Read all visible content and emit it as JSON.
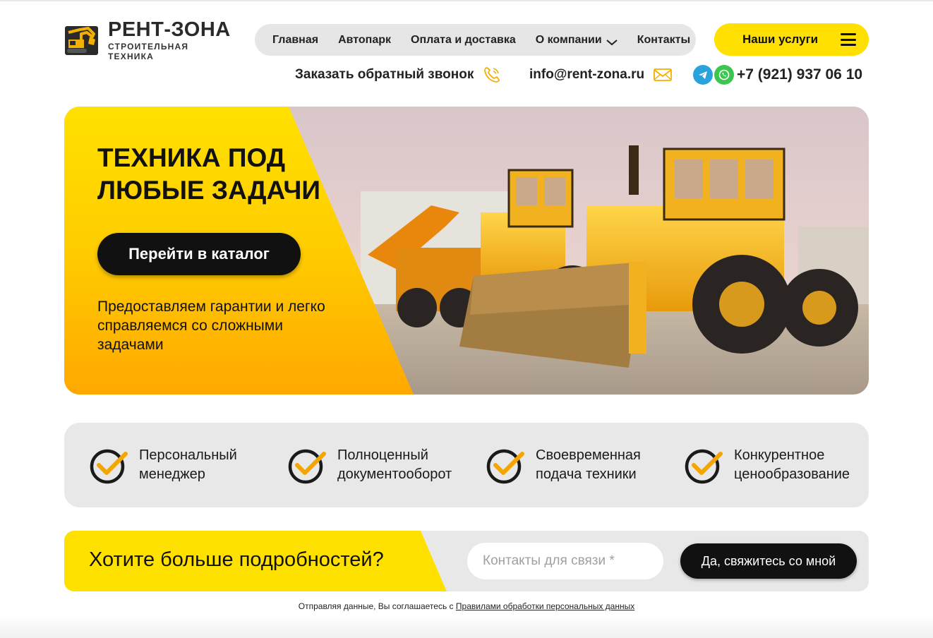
{
  "brand": {
    "name": "РЕНТ-ЗОНА",
    "tagline": "СТРОИТЕЛЬНАЯ ТЕХНИКА",
    "accent": "#ffe000",
    "dark": "#111111"
  },
  "nav": {
    "items": [
      {
        "label": "Главная"
      },
      {
        "label": "Автопарк"
      },
      {
        "label": "Оплата и доставка"
      },
      {
        "label": "О компании",
        "has_dropdown": true
      },
      {
        "label": "Контакты"
      }
    ],
    "services_label": "Наши услуги"
  },
  "contacts": {
    "callback_label": "Заказать обратный звонок",
    "email": "info@rent-zona.ru",
    "phone": "+7 (921) 937 06 10",
    "messengers": [
      "telegram-icon",
      "whatsapp-icon"
    ]
  },
  "hero": {
    "title": "ТЕХНИКА ПОД ЛЮБЫЕ ЗАДАЧИ",
    "button_label": "Перейти в каталог",
    "text": "Предоставляем гарантии и легко справляемся со сложными задачами"
  },
  "features": [
    {
      "line1": "Персональный",
      "line2": "менеджер"
    },
    {
      "line1": "Полноценный",
      "line2": "документооборот"
    },
    {
      "line1": "Своевременная",
      "line2": "подача техники"
    },
    {
      "line1": "Конкурентное",
      "line2": "ценообразование"
    }
  ],
  "cta": {
    "title": "Хотите больше подробностей?",
    "input_placeholder": "Контакты для связи *",
    "button_label": "Да, свяжитесь со мной"
  },
  "consent": {
    "text": "Отправляя данные, Вы соглашаетесь с ",
    "link": "Правилами обработки персональных данных"
  }
}
